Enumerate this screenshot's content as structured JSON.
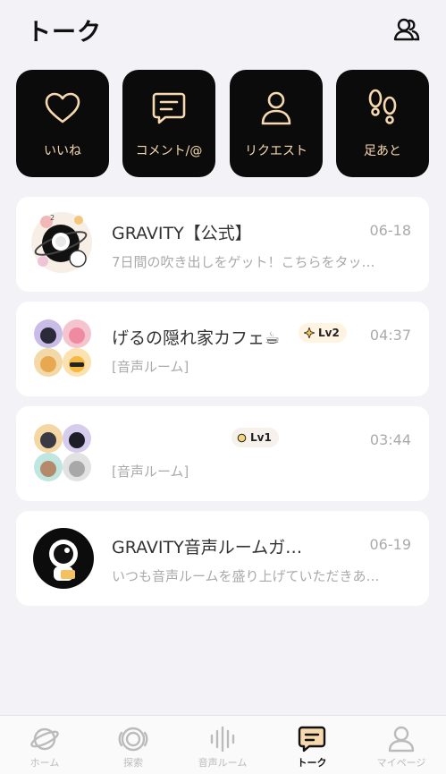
{
  "header": {
    "title": "トーク"
  },
  "quick_actions": [
    {
      "label": "いいね",
      "icon": "heart-icon"
    },
    {
      "label": "コメント/@",
      "icon": "comment-icon"
    },
    {
      "label": "リクエスト",
      "icon": "person-icon"
    },
    {
      "label": "足あと",
      "icon": "footprints-icon"
    }
  ],
  "conversations": [
    {
      "name": "GRAVITY【公式】",
      "time": "06-18",
      "preview": "7日間の吹き出しをゲット！こちらをタッ…"
    },
    {
      "name": "げるの隠れ家カフェ☕",
      "time": "04:37",
      "preview": "[音声ルーム]",
      "level": "Lv2"
    },
    {
      "name": "",
      "time": "03:44",
      "preview": "[音声ルーム]",
      "level": "Lv1"
    },
    {
      "name": "GRAVITY音声ルームガ…",
      "time": "06-19",
      "preview": "いつも音声ルームを盛り上げていただきあ…"
    }
  ],
  "tabs": [
    {
      "label": "ホーム",
      "icon": "planet-icon"
    },
    {
      "label": "探索",
      "icon": "explore-icon"
    },
    {
      "label": "音声ルーム",
      "icon": "soundwave-icon"
    },
    {
      "label": "トーク",
      "icon": "chat-icon",
      "active": true
    },
    {
      "label": "マイページ",
      "icon": "profile-icon"
    }
  ],
  "colors": {
    "accent": "#f6d9ae",
    "tile_bg": "#0b0b0b",
    "background": "#f3f2f6"
  }
}
